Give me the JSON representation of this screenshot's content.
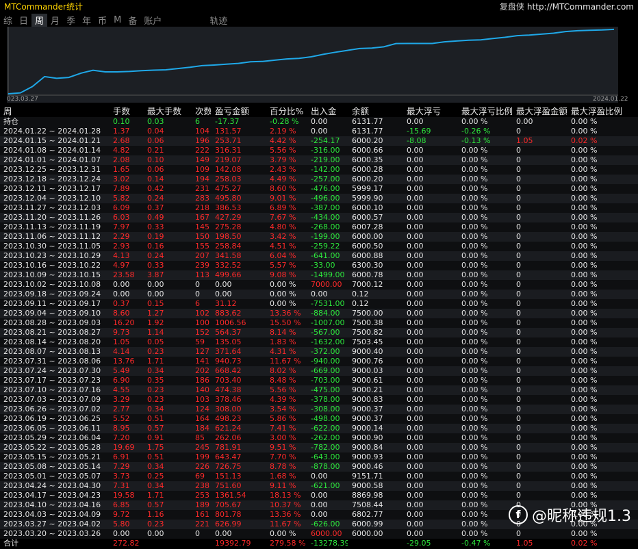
{
  "title": "MTCommander统计",
  "site": {
    "brand": "复盘侠",
    "url": "http://MTCommander.com"
  },
  "tabs": [
    "综",
    "日",
    "周",
    "月",
    "季",
    "年",
    "币",
    "M",
    "备",
    "账户",
    "轨迹"
  ],
  "active_tab": 2,
  "chart": {
    "start_label": "023.03.27",
    "end_label": "2024.01.22",
    "line_color": "#1fa8e8",
    "values": [
      0,
      272.82,
      2221,
      5276,
      4755.57,
      5017.7,
      6319.4,
      7225.62,
      6713.94,
      6720.9,
      6853.4,
      7096.63,
      7251.78,
      7353.98,
      7749.35,
      8138.61,
      8626.15,
      8822.85,
      9078.2,
      9325.29,
      9798.4,
      9925.87,
      10316.56,
      10691.86,
      10875.03,
      11348.87,
      12089.57,
      12751.9,
      13313.4,
      13880.51,
      14016.05,
      14400.06,
      15418.63,
      15430.83,
      15430.83,
      15430.83,
      15931.03,
      16186.33,
      16418.48,
      16541.67,
      16961.96,
      17332.57,
      17828.37,
      18014.85,
      18294.13,
      18589.79,
      19097.3,
      19350.3,
      19482.23,
      19572.66,
      19764.79
    ]
  },
  "headers": [
    "周",
    "手数",
    "最大手数",
    "次数",
    "盈亏金额",
    "百分比%",
    "出入金",
    "余额",
    "最大浮亏",
    "最大浮亏比例",
    "最大浮盈金额",
    "最大浮盈比例"
  ],
  "holding": [
    "持仓",
    "0.10",
    "0.03",
    "6",
    "-17.37",
    "-0.28 %",
    "0.00",
    "6131.77",
    "0.00",
    "0.00 %",
    "0.00",
    "0.00 %"
  ],
  "holding_classes": [
    "zero",
    "neg",
    "neg",
    "neg",
    "neg",
    "neg",
    "zero",
    "zero",
    "zero",
    "zero",
    "zero",
    "zero"
  ],
  "rows": [
    [
      "2024.01.22 ~ 2024.01.28",
      "1.37",
      "0.04",
      "104",
      "131.57",
      "2.19 %",
      "0.00",
      "6131.77",
      "-15.69",
      "-0.26 %",
      "0",
      "0.00 %"
    ],
    [
      "2024.01.15 ~ 2024.01.21",
      "2.68",
      "0.06",
      "196",
      "253.71",
      "4.42 %",
      "-254.17",
      "6000.20",
      "-8.08",
      "-0.13 %",
      "1.05",
      "0.02 %"
    ],
    [
      "2024.01.08 ~ 2024.01.14",
      "4.82",
      "0.21",
      "222",
      "316.31",
      "5.56 %",
      "-316.00",
      "6000.66",
      "0.00",
      "0.00 %",
      "0",
      "0.00 %"
    ],
    [
      "2024.01.01 ~ 2024.01.07",
      "2.08",
      "0.10",
      "149",
      "219.07",
      "3.79 %",
      "-219.00",
      "6000.35",
      "0.00",
      "0.00 %",
      "0",
      "0.00 %"
    ],
    [
      "2023.12.25 ~ 2023.12.31",
      "1.65",
      "0.06",
      "109",
      "142.08",
      "2.43 %",
      "-142.00",
      "6000.28",
      "0.00",
      "0.00 %",
      "0",
      "0.00 %"
    ],
    [
      "2023.12.18 ~ 2023.12.24",
      "3.02",
      "0.14",
      "194",
      "258.03",
      "4.49 %",
      "-257.00",
      "6000.20",
      "0.00",
      "0.00 %",
      "0",
      "0.00 %"
    ],
    [
      "2023.12.11 ~ 2023.12.17",
      "7.89",
      "0.42",
      "231",
      "475.27",
      "8.60 %",
      "-476.00",
      "5999.17",
      "0.00",
      "0.00 %",
      "0",
      "0.00 %"
    ],
    [
      "2023.12.04 ~ 2023.12.10",
      "5.82",
      "0.24",
      "283",
      "495.80",
      "9.01 %",
      "-496.00",
      "5999.90",
      "0.00",
      "0.00 %",
      "0",
      "0.00 %"
    ],
    [
      "2023.11.27 ~ 2023.12.03",
      "6.09",
      "0.37",
      "218",
      "386.53",
      "6.89 %",
      "-387.00",
      "6000.10",
      "0.00",
      "0.00 %",
      "0",
      "0.00 %"
    ],
    [
      "2023.11.20 ~ 2023.11.26",
      "6.03",
      "0.49",
      "167",
      "427.29",
      "7.67 %",
      "-434.00",
      "6000.57",
      "0.00",
      "0.00 %",
      "0",
      "0.00 %"
    ],
    [
      "2023.11.13 ~ 2023.11.19",
      "7.97",
      "0.33",
      "145",
      "275.28",
      "4.80 %",
      "-268.00",
      "6007.28",
      "0.00",
      "0.00 %",
      "0",
      "0.00 %"
    ],
    [
      "2023.11.06 ~ 2023.11.12",
      "2.29",
      "0.19",
      "150",
      "198.50",
      "3.42 %",
      "-199.00",
      "6000.00",
      "0.00",
      "0.00 %",
      "0",
      "0.00 %"
    ],
    [
      "2023.10.30 ~ 2023.11.05",
      "2.93",
      "0.16",
      "155",
      "258.84",
      "4.51 %",
      "-259.22",
      "6000.50",
      "0.00",
      "0.00 %",
      "0",
      "0.00 %"
    ],
    [
      "2023.10.23 ~ 2023.10.29",
      "4.13",
      "0.24",
      "207",
      "341.58",
      "6.04 %",
      "-641.00",
      "6000.88",
      "0.00",
      "0.00 %",
      "0",
      "0.00 %"
    ],
    [
      "2023.10.16 ~ 2023.10.22",
      "4.97",
      "0.33",
      "239",
      "332.52",
      "5.57 %",
      "-33.00",
      "6300.30",
      "0.00",
      "0.00 %",
      "0",
      "0.00 %"
    ],
    [
      "2023.10.09 ~ 2023.10.15",
      "23.58",
      "3.87",
      "113",
      "499.66",
      "9.08 %",
      "-1499.00",
      "6000.78",
      "0.00",
      "0.00 %",
      "0",
      "0.00 %"
    ],
    [
      "2023.10.02 ~ 2023.10.08",
      "0.00",
      "0.00",
      "0",
      "0.00",
      "0.00 %",
      "7000.00",
      "7000.12",
      "0.00",
      "0.00 %",
      "0",
      "0.00 %"
    ],
    [
      "2023.09.18 ~ 2023.09.24",
      "0.00",
      "0.00",
      "0",
      "0.00",
      "0.00 %",
      "0.00",
      "0.12",
      "0.00",
      "0.00 %",
      "0",
      "0.00 %"
    ],
    [
      "2023.09.11 ~ 2023.09.17",
      "0.37",
      "0.15",
      "6",
      "31.12",
      "0.00 %",
      "-7531.00",
      "0.12",
      "0.00",
      "0.00 %",
      "0",
      "0.00 %"
    ],
    [
      "2023.09.04 ~ 2023.09.10",
      "8.60",
      "1.27",
      "102",
      "883.62",
      "13.36 %",
      "-884.00",
      "7500.00",
      "0.00",
      "0.00 %",
      "0",
      "0.00 %"
    ],
    [
      "2023.08.28 ~ 2023.09.03",
      "16.20",
      "1.92",
      "100",
      "1006.56",
      "15.50 %",
      "-1007.00",
      "7500.38",
      "0.00",
      "0.00 %",
      "0",
      "0.00 %"
    ],
    [
      "2023.08.21 ~ 2023.08.27",
      "9.73",
      "1.14",
      "152",
      "564.37",
      "8.14 %",
      "-567.00",
      "7500.82",
      "0.00",
      "0.00 %",
      "0",
      "0.00 %"
    ],
    [
      "2023.08.14 ~ 2023.08.20",
      "1.05",
      "0.05",
      "59",
      "135.05",
      "1.83 %",
      "-1632.00",
      "7503.45",
      "0.00",
      "0.00 %",
      "0",
      "0.00 %"
    ],
    [
      "2023.08.07 ~ 2023.08.13",
      "4.14",
      "0.23",
      "127",
      "371.64",
      "4.31 %",
      "-372.00",
      "9000.40",
      "0.00",
      "0.00 %",
      "0",
      "0.00 %"
    ],
    [
      "2023.07.31 ~ 2023.08.06",
      "13.76",
      "1.71",
      "141",
      "940.73",
      "11.67 %",
      "-940.00",
      "9000.76",
      "0.00",
      "0.00 %",
      "0",
      "0.00 %"
    ],
    [
      "2023.07.24 ~ 2023.07.30",
      "5.49",
      "0.34",
      "202",
      "668.42",
      "8.02 %",
      "-669.00",
      "9000.03",
      "0.00",
      "0.00 %",
      "0",
      "0.00 %"
    ],
    [
      "2023.07.17 ~ 2023.07.23",
      "6.90",
      "0.35",
      "186",
      "703.40",
      "8.48 %",
      "-703.00",
      "9000.61",
      "0.00",
      "0.00 %",
      "0",
      "0.00 %"
    ],
    [
      "2023.07.10 ~ 2023.07.16",
      "4.55",
      "0.23",
      "140",
      "474.38",
      "5.56 %",
      "-475.00",
      "9000.21",
      "0.00",
      "0.00 %",
      "0",
      "0.00 %"
    ],
    [
      "2023.07.03 ~ 2023.07.09",
      "3.29",
      "0.23",
      "103",
      "378.46",
      "4.39 %",
      "-378.00",
      "9000.83",
      "0.00",
      "0.00 %",
      "0",
      "0.00 %"
    ],
    [
      "2023.06.26 ~ 2023.07.02",
      "2.77",
      "0.34",
      "124",
      "308.00",
      "3.54 %",
      "-308.00",
      "9000.37",
      "0.00",
      "0.00 %",
      "0",
      "0.00 %"
    ],
    [
      "2023.06.19 ~ 2023.06.25",
      "5.52",
      "0.51",
      "164",
      "498.23",
      "5.86 %",
      "-498.00",
      "9000.37",
      "0.00",
      "0.00 %",
      "0",
      "0.00 %"
    ],
    [
      "2023.06.05 ~ 2023.06.11",
      "8.95",
      "0.57",
      "184",
      "621.24",
      "7.41 %",
      "-622.00",
      "9000.14",
      "0.00",
      "0.00 %",
      "0",
      "0.00 %"
    ],
    [
      "2023.05.29 ~ 2023.06.04",
      "7.20",
      "0.91",
      "85",
      "262.06",
      "3.00 %",
      "-262.00",
      "9000.90",
      "0.00",
      "0.00 %",
      "0",
      "0.00 %"
    ],
    [
      "2023.05.22 ~ 2023.05.28",
      "19.69",
      "1.75",
      "245",
      "781.91",
      "9.51 %",
      "-782.00",
      "9000.84",
      "0.00",
      "0.00 %",
      "0",
      "0.00 %"
    ],
    [
      "2023.05.15 ~ 2023.05.21",
      "6.91",
      "0.51",
      "199",
      "643.47",
      "7.70 %",
      "-643.00",
      "9000.93",
      "0.00",
      "0.00 %",
      "0",
      "0.00 %"
    ],
    [
      "2023.05.08 ~ 2023.05.14",
      "7.29",
      "0.34",
      "226",
      "726.75",
      "8.78 %",
      "-878.00",
      "9000.46",
      "0.00",
      "0.00 %",
      "0",
      "0.00 %"
    ],
    [
      "2023.05.01 ~ 2023.05.07",
      "3.73",
      "0.25",
      "69",
      "151.13",
      "1.68 %",
      "0.00",
      "9151.71",
      "0.00",
      "0.00 %",
      "0",
      "0.00 %"
    ],
    [
      "2023.04.24 ~ 2023.04.30",
      "7.31",
      "0.34",
      "238",
      "751.60",
      "9.11 %",
      "-621.00",
      "9000.58",
      "0.00",
      "0.00 %",
      "0",
      "0.00 %"
    ],
    [
      "2023.04.17 ~ 2023.04.23",
      "19.58",
      "1.71",
      "253",
      "1361.54",
      "18.13 %",
      "0.00",
      "8869.98",
      "0.00",
      "0.00 %",
      "0",
      "0.00 %"
    ],
    [
      "2023.04.10 ~ 2023.04.16",
      "6.85",
      "0.57",
      "189",
      "705.67",
      "10.37 %",
      "0.00",
      "7508.44",
      "0.00",
      "0.00 %",
      "0",
      "0.00 %"
    ],
    [
      "2023.04.03 ~ 2023.04.09",
      "9.72",
      "1.16",
      "161",
      "801.78",
      "13.36 %",
      "0.00",
      "6802.77",
      "0.00",
      "0.00 %",
      "0",
      "0.00 %"
    ],
    [
      "2023.03.27 ~ 2023.04.02",
      "5.80",
      "0.23",
      "221",
      "626.99",
      "11.67 %",
      "-626.00",
      "6000.99",
      "0.00",
      "0.00 %",
      "0",
      "0.00 %"
    ],
    [
      "2023.03.20 ~ 2023.03.26",
      "0.00",
      "0.00",
      "0",
      "0.00",
      "0.00 %",
      "6000.00",
      "6000.00",
      "0.00",
      "0.00 %",
      "0",
      "0.00 %"
    ]
  ],
  "total": [
    "合计",
    "272.82",
    "",
    "",
    "19392.79",
    "279.58 %",
    "-13278.39",
    "",
    "-29.05",
    "-0.47 %",
    "1.05",
    "0.02 %"
  ],
  "total_classes": [
    "zero",
    "pos",
    "zero",
    "zero",
    "pos",
    "pos",
    "neg",
    "zero",
    "neg",
    "neg",
    "pos",
    "pos"
  ],
  "watermark": "@昵称违规1.3",
  "colors": {
    "positive": "#ff2a2a",
    "negative": "#2de83d",
    "neutral": "#e6e6e6",
    "title": "#ffd400"
  }
}
